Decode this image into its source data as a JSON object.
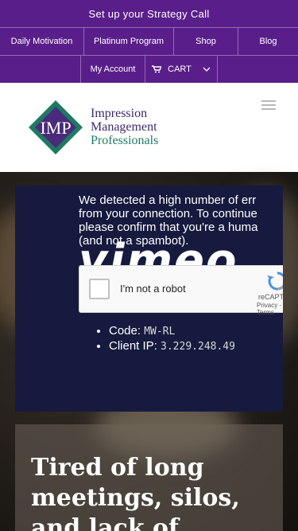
{
  "top_bar": {
    "cta_label": "Set up your Strategy Call",
    "nav": [
      "Daily Motivation",
      "Platinum Program",
      "Shop",
      "Blog"
    ],
    "account_label": "My Account",
    "cart_label": "CART",
    "background": "#5a1e8a"
  },
  "header": {
    "logo": {
      "monogram": "IMP",
      "line1": "Impression",
      "line2": "Management",
      "line3": "Professionals"
    },
    "menu_icon": "hamburger-icon"
  },
  "captcha": {
    "message": [
      "We detected a high number of err",
      "from your connection. To continue",
      "please confirm that you're a huma",
      "(and not a spambot)."
    ],
    "watermark": "vimeo",
    "checkbox_label": "I'm not a robot",
    "brand": "reCAPTCHA",
    "terms": "Privacy - Terms",
    "code_label": "Code:",
    "code_value": "MW-RL",
    "ip_label": "Client IP:",
    "ip_value": "3.229.248.49"
  },
  "promo": {
    "heading": "Tired of long meetings, silos, and lack of"
  }
}
